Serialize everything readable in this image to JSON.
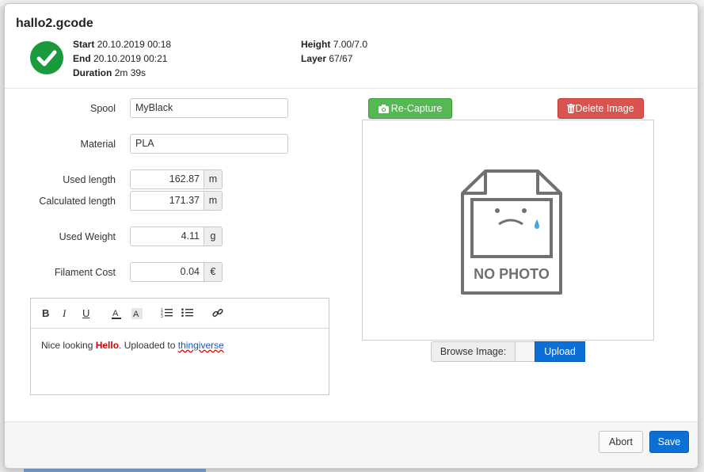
{
  "header": {
    "title": "hallo2.gcode",
    "start_label": "Start",
    "start_value": "20.10.2019 00:18",
    "end_label": "End",
    "end_value": "20.10.2019 00:21",
    "duration_label": "Duration",
    "duration_value": "2m 39s",
    "height_label": "Height",
    "height_value": "7.00/7.0",
    "layer_label": "Layer",
    "layer_value": "67/67",
    "status_icon": "check-circle-icon",
    "status_color": "#1a9a3d"
  },
  "form": {
    "spool_label": "Spool",
    "spool_value": "MyBlack",
    "material_label": "Material",
    "material_value": "PLA",
    "used_length_label": "Used length",
    "used_length_value": "162.87",
    "used_length_unit": "m",
    "calc_length_label": "Calculated length",
    "calc_length_value": "171.37",
    "calc_length_unit": "m",
    "used_weight_label": "Used Weight",
    "used_weight_value": "4.11",
    "used_weight_unit": "g",
    "cost_label": "Filament Cost",
    "cost_value": "0.04",
    "cost_unit": "€"
  },
  "editor": {
    "toolbar": [
      "bold-icon",
      "italic-icon",
      "underline-icon",
      "font-color-icon",
      "highlight-icon",
      "ordered-list-icon",
      "bullet-list-icon",
      "link-icon"
    ],
    "text_before": "Nice looking ",
    "text_highlight": "Hello",
    "text_middle": ". Uploaded to ",
    "text_link": "thingiverse",
    "highlight_color": "#d40000"
  },
  "image": {
    "recapture_label": "Re-Capture",
    "delete_label": "Delete Image",
    "placeholder_text": "NO PHOTO",
    "browse_label": "Browse Image:",
    "upload_label": "Upload",
    "recapture_color": "#55b855",
    "delete_color": "#d9534f"
  },
  "footer": {
    "abort_label": "Abort",
    "save_label": "Save",
    "primary_color": "#0c6fd6"
  }
}
